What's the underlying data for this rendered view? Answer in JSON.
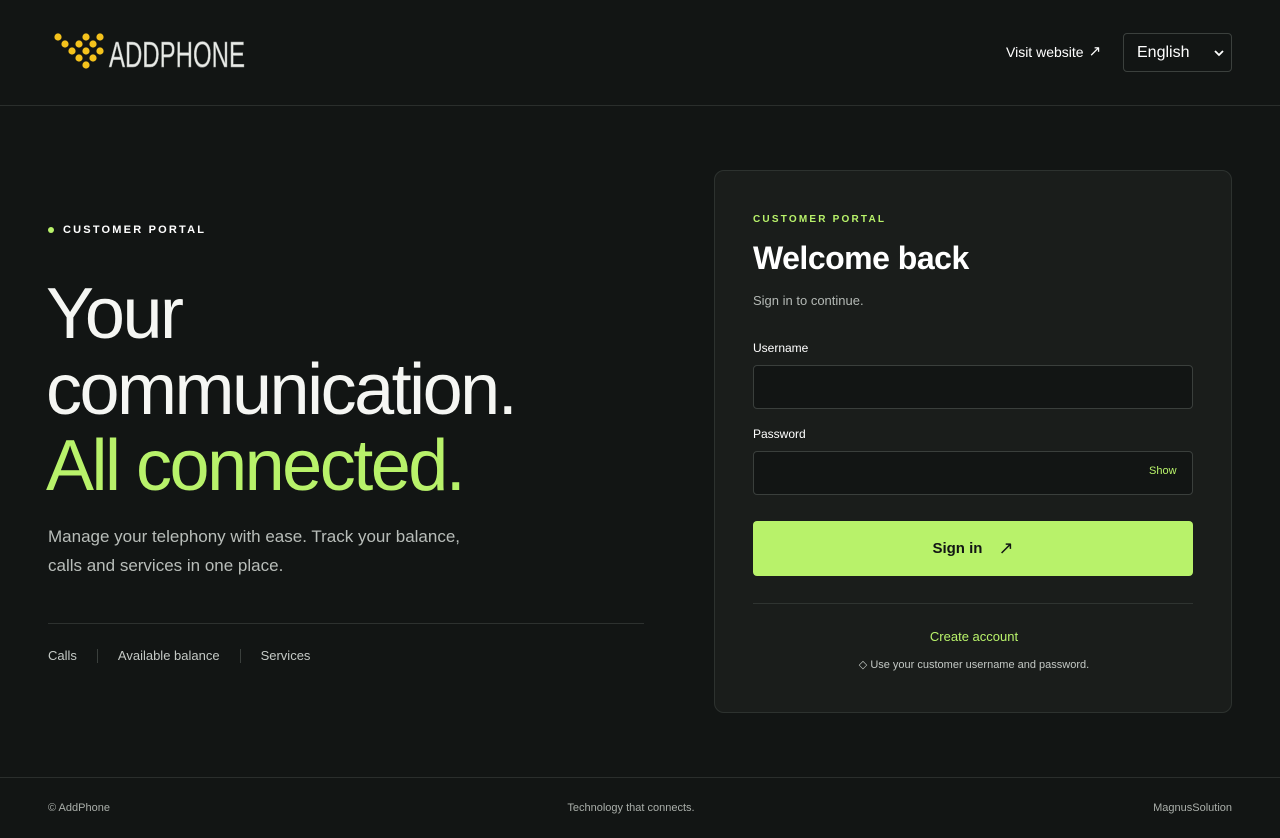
{
  "header": {
    "logo_text": "ADDPHONE",
    "visit_link": "Visit website",
    "language": {
      "selected": "English"
    }
  },
  "hero": {
    "eyebrow": "CUSTOMER PORTAL",
    "headline_line1": "Your",
    "headline_line2": "communication.",
    "headline_line3": "All connected.",
    "lead": "Manage your telephony with ease. Track your balance, calls and services in one place.",
    "features": [
      "Calls",
      "Available balance",
      "Services"
    ]
  },
  "login": {
    "eyebrow": "CUSTOMER PORTAL",
    "title": "Welcome back",
    "subtitle": "Sign in to continue.",
    "username_label": "Username",
    "username_value": "",
    "password_label": "Password",
    "password_value": "",
    "show_label": "Show",
    "signin_label": "Sign in",
    "create_account": "Create account",
    "hint": "◇ Use your customer username and password."
  },
  "footer": {
    "copyright": "© AddPhone",
    "tagline": "Technology that connects.",
    "credit": "MagnusSolution"
  },
  "colors": {
    "background": "#121514",
    "card": "#1a1d1b",
    "accent": "#b8f26a",
    "logo_dots": "#f4c21c"
  },
  "icons": {
    "visit": "arrow-up-right-icon",
    "signin": "arrow-up-right-icon",
    "language": "chevron-down-icon"
  }
}
